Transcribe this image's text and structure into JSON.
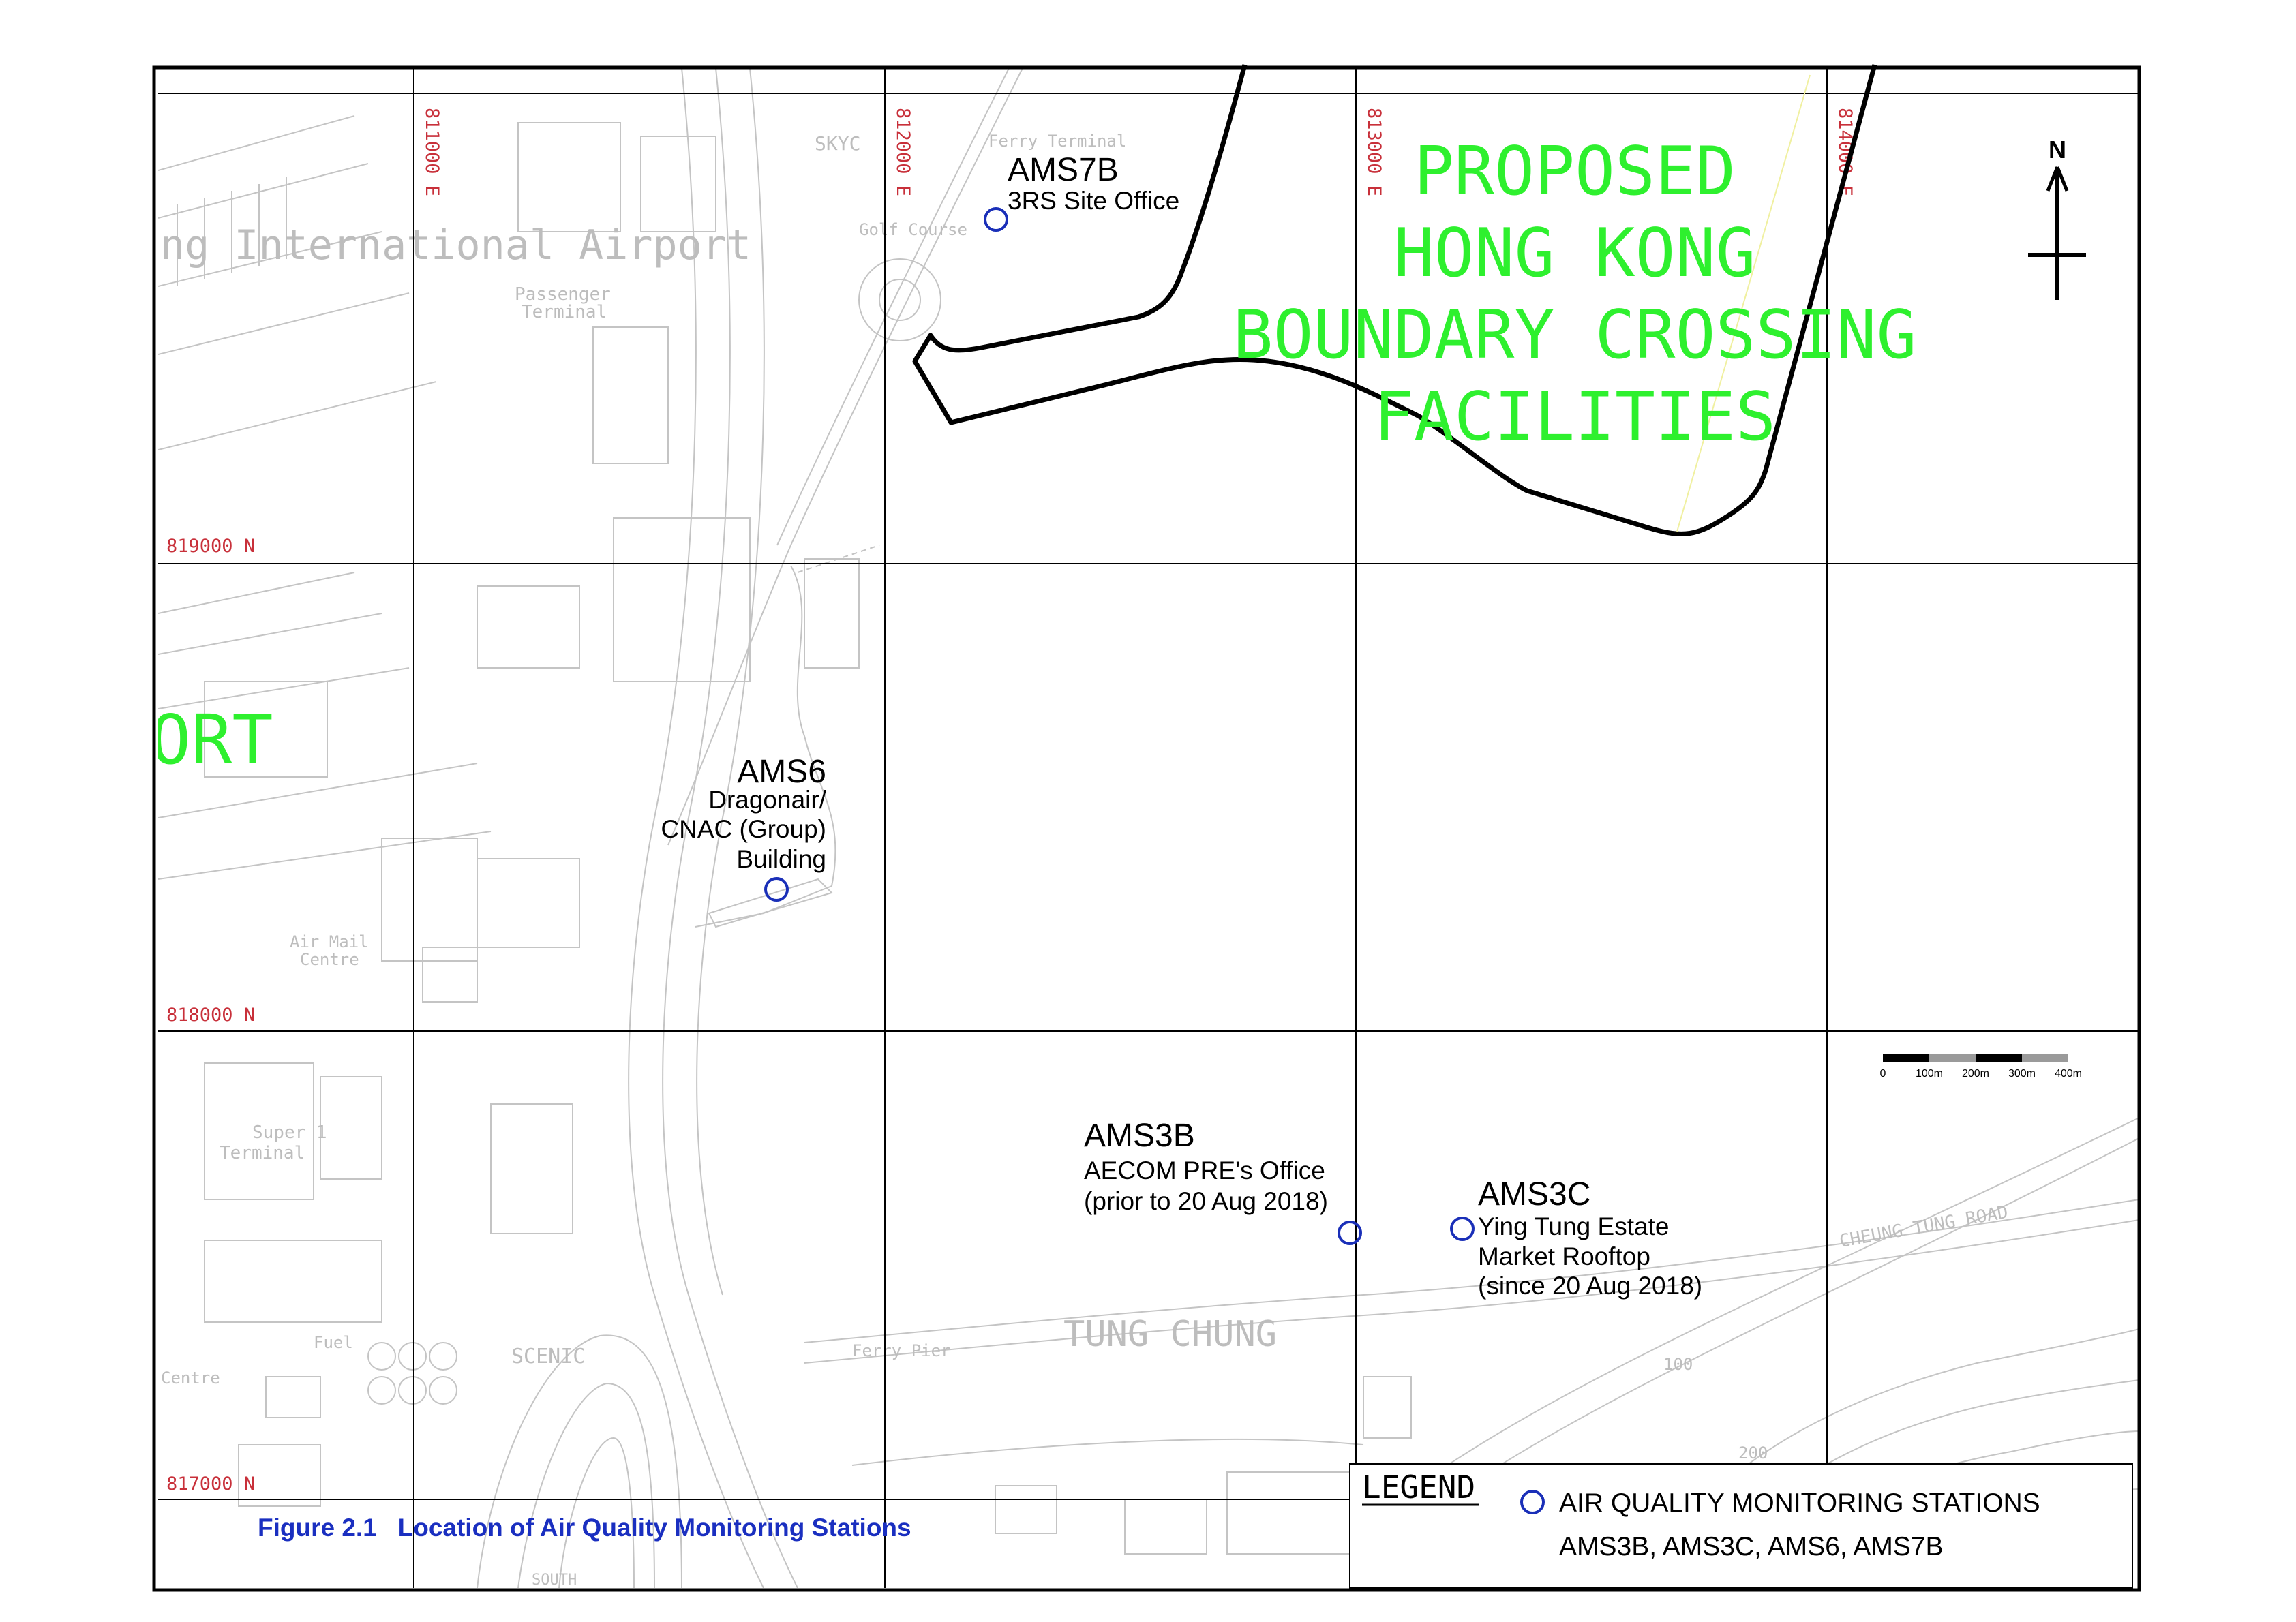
{
  "grid": {
    "eastings": [
      "811000 E",
      "812000 E",
      "813000 E",
      "814000 E"
    ],
    "northings": [
      "819000 N",
      "818000 N",
      "817000 N"
    ]
  },
  "basemap_labels": {
    "airport_fragment": "ORT",
    "intl_airport": "ng International Airport",
    "passenger_terminal_1": "Passenger",
    "passenger_terminal_2": "Terminal",
    "sky_city": "SKYC",
    "ferry_terminal": "Ferry Terminal",
    "golf": "Golf Course",
    "air_mail_1": "Air Mail",
    "air_mail_2": "Centre",
    "super_terminal_1": "Super 1",
    "super_terminal_2": "Terminal",
    "fuel": "Fuel",
    "centre": "Centre",
    "scenic": "SCENIC",
    "ferry_pier": "Ferry Pier",
    "tung_chung": "TUNG CHUNG",
    "cheung_tung_road": "CHEUNG TUNG ROAD",
    "south": "SOUTH",
    "spot_height_1": "100",
    "spot_height_2": "200"
  },
  "proposed_area": {
    "lines": [
      "PROPOSED",
      "HONG KONG",
      "BOUNDARY CROSSING",
      "FACILITIES"
    ]
  },
  "stations": [
    {
      "id": "AMS7B",
      "name": "AMS7B",
      "desc": [
        "3RS Site Office"
      ]
    },
    {
      "id": "AMS6",
      "name": "AMS6",
      "desc": [
        "Dragonair/",
        "CNAC (Group)",
        "Building"
      ]
    },
    {
      "id": "AMS3B",
      "name": "AMS3B",
      "desc": [
        "AECOM PRE's Office",
        "(prior to 20 Aug 2018)"
      ]
    },
    {
      "id": "AMS3C",
      "name": "AMS3C",
      "desc": [
        "Ying Tung Estate",
        "Market Rooftop",
        "(since 20 Aug 2018)"
      ]
    }
  ],
  "north_arrow": {
    "label": "N"
  },
  "scale_bar": {
    "labels": [
      "0",
      "100m",
      "200m",
      "300m",
      "400m"
    ]
  },
  "legend": {
    "title": "LEGEND",
    "item_label": "AIR QUALITY MONITORING STATIONS",
    "item_stations": "AMS3B, AMS3C, AMS6, AMS7B",
    "marker_color": "#1a2fb8"
  },
  "caption": "Figure 2.1   Location of Air Quality Monitoring Stations",
  "colors": {
    "grid": "#000000",
    "grid_label": "#c8303a",
    "proposed_text": "#2ef02e",
    "station_marker": "#1a2fb8",
    "caption": "#1a2fc0"
  }
}
